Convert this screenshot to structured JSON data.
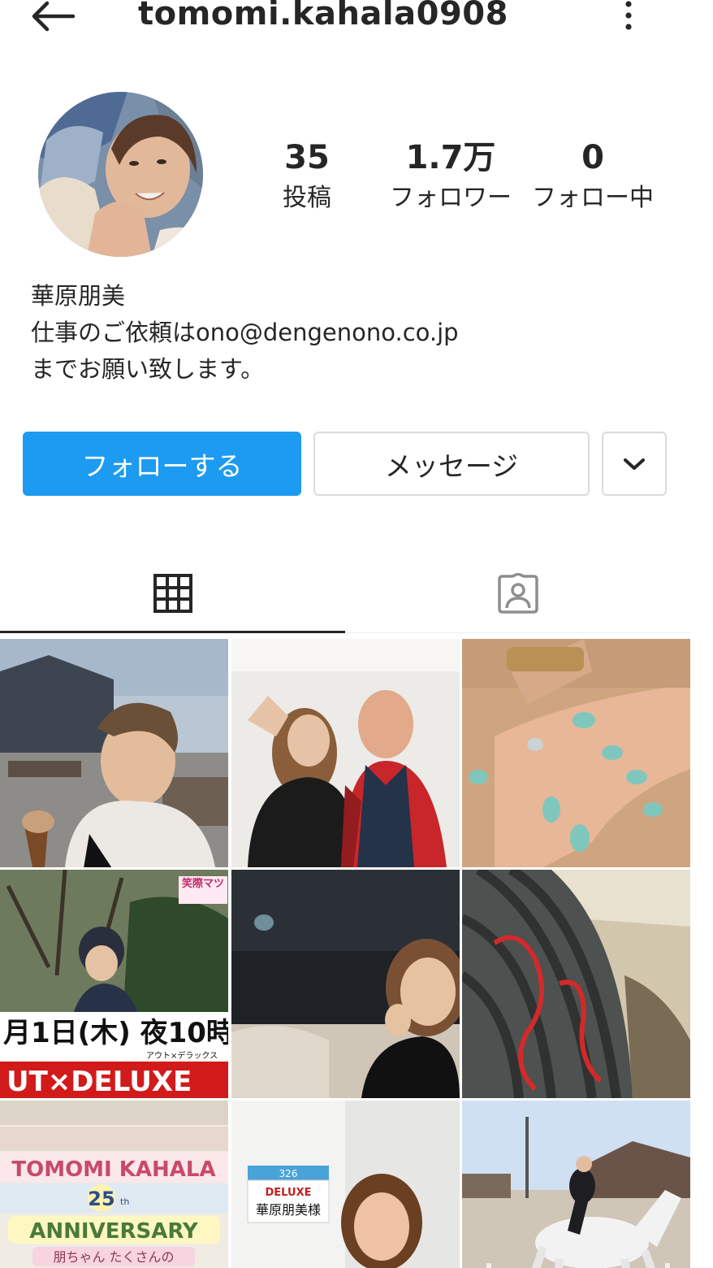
{
  "header": {
    "username": "tomomi.kahala0908",
    "back_icon": "arrow-left-icon",
    "more_icon": "more-vertical-icon"
  },
  "stats": {
    "posts_count": "35",
    "posts_label": "投稿",
    "followers_count": "1.7万",
    "followers_label": "フォロワー",
    "following_count": "0",
    "following_label": "フォロー中"
  },
  "bio": {
    "name": "華原朋美",
    "line1": "仕事のご依頼はono@dengenono.co.jp",
    "line2": "までお願い致します。"
  },
  "actions": {
    "follow_label": "フォローする",
    "message_label": "メッセージ",
    "suggest_icon": "chevron-down-icon"
  },
  "tabs": {
    "grid_icon": "grid-icon",
    "tagged_icon": "tagged-person-icon"
  },
  "posts": [
    {
      "caption": ""
    },
    {
      "caption": ""
    },
    {
      "caption": ""
    },
    {
      "caption": "月1日(木) 夜10時"
    },
    {
      "caption": ""
    },
    {
      "caption": ""
    },
    {
      "caption": "TOMOMI KAHALA"
    },
    {
      "caption": "華原朋美様"
    },
    {
      "caption": ""
    }
  ],
  "post_texts": {
    "p4_top": "笑際マツ",
    "p4_line": "月1日(木) 夜10時",
    "p4_sub": "アウト×デラックス",
    "p4_logo": "UT×DELUXE",
    "p7_title": "TOMOMI KAHALA",
    "p7_num": "25",
    "p7_sub": "th",
    "p7_ann": "ANNIVERSARY",
    "p7_bottom": "朋ちゃん たくさんの",
    "p8_num": "326",
    "p8_logo": "DELUXE",
    "p8_name": "華原朋美様"
  },
  "colors": {
    "accent": "#1d9bf0",
    "border": "#dbdbdb",
    "text": "#262626"
  }
}
